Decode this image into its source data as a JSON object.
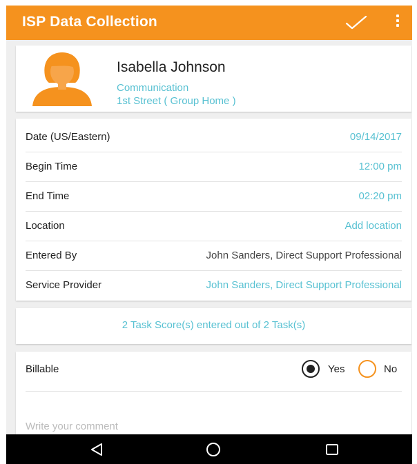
{
  "app": {
    "title": "ISP Data Collection",
    "accent_color": "#f5921e",
    "link_color": "#58c1d2",
    "actions": [
      "check-icon",
      "more-vert-icon"
    ]
  },
  "profile": {
    "name": "Isabella Johnson",
    "program": "Communication",
    "location": "1st Street ( Group Home )",
    "avatar": "person-avatar-icon"
  },
  "details": [
    {
      "label": "Date (US/Eastern)",
      "value": "09/14/2017"
    },
    {
      "label": "Begin Time",
      "value": "12:00 pm"
    },
    {
      "label": "End Time",
      "value": "02:20 pm"
    },
    {
      "label": "Location",
      "value": "Add location"
    },
    {
      "label": "Entered By",
      "value": "John Sanders, Direct Support Professional"
    },
    {
      "label": "Service Provider",
      "value": "John Sanders, Direct Support Professional"
    }
  ],
  "tasks": {
    "summary": "2 Task Score(s) entered out of 2 Task(s)"
  },
  "billable": {
    "label": "Billable",
    "yes_label": "Yes",
    "no_label": "No",
    "selected": "Yes",
    "comment_placeholder": "Write your comment"
  },
  "navbar": {
    "buttons": [
      "back-icon",
      "home-icon",
      "recents-icon"
    ]
  }
}
